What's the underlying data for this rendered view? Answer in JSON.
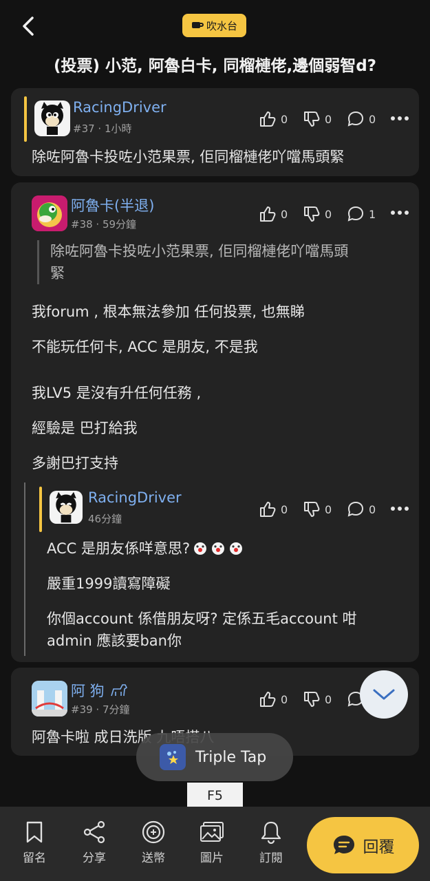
{
  "header": {
    "forum_tag": "吹水台",
    "thread_title": "(投票) 小范, 阿魯白卡, 同榴槤佬,邊個弱智d?"
  },
  "posts": [
    {
      "username": "RacingDriver",
      "floor": "#37",
      "time": "1小時",
      "likes": "0",
      "dislikes": "0",
      "comments": "0",
      "content": [
        "除咗阿魯卡投咗小范果票, 佢同榴槤佬吖噹馬頭緊"
      ]
    },
    {
      "username": "阿魯卡(半退)",
      "floor": "#38",
      "time": "59分鐘",
      "likes": "0",
      "dislikes": "0",
      "comments": "1",
      "quote": [
        "除咗阿魯卡投咗小范果票, 佢同榴槤佬吖噹馬頭",
        "緊"
      ],
      "content": [
        "我forum , 根本無法參加 任何投票, 也無睇",
        "不能玩任何卡, ACC 是朋友, 不是我",
        "我LV5 是沒有升任何任務 ,",
        "經驗是 巴打給我",
        "多謝巴打支持"
      ],
      "reply": {
        "username": "RacingDriver",
        "time": "46分鐘",
        "likes": "0",
        "dislikes": "0",
        "comments": "0",
        "content": [
          "ACC 是朋友係咩意思?",
          "嚴重1999讀寫障礙",
          "你個account 係借朋友呀? 定係五毛account 咁",
          "admin 應該要ban你"
        ]
      }
    },
    {
      "username": "阿 狗",
      "floor": "#39",
      "time": "7分鐘",
      "likes": "0",
      "dislikes": "0",
      "content": [
        "阿魯卡啦 成日洗版 九唔搭八"
      ]
    }
  ],
  "overlay": {
    "toast_label": "Triple Tap",
    "key_label": "F5"
  },
  "bottom_nav": {
    "bookmark": "留名",
    "share": "分享",
    "gift": "送幣",
    "image": "圖片",
    "subscribe": "訂閱",
    "reply": "回覆"
  },
  "colors": {
    "accent": "#f5c542",
    "username": "#7fb0f0",
    "background": "#121212",
    "card": "#232323"
  }
}
